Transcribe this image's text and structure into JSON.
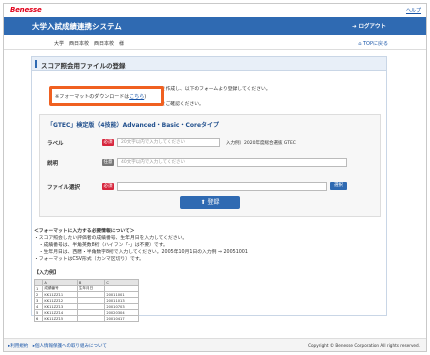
{
  "brand": {
    "logo_prefix": "Benesse",
    "help": "ヘルプ"
  },
  "header": {
    "title": "大学入試成績連携システム",
    "logout": "ログアウト"
  },
  "subbar": {
    "user": "大学　西日本校　西日本校　様",
    "toppage": "TOPに戻る"
  },
  "page": {
    "title": "スコア照会用ファイルの登録",
    "desc1": "会用ファイルを作成し、以下のフォームより登録してください。",
    "desc2": "ページの下部をご確認ください。",
    "download_prefix": "※フォーマットのダウンロードは",
    "download_link": "こちら"
  },
  "form": {
    "title": "「GTEC」検定版（4技能）Advanced・Basic・Coreタイプ",
    "label_field": {
      "label": "ラベル",
      "tag": "必須",
      "placeholder": "20文字以内で入力してください",
      "hint": "入力例）2020年度総合選抜 GTEC"
    },
    "note_field": {
      "label": "説明",
      "tag": "任意",
      "placeholder": "40文字以内で入力してください"
    },
    "file_field": {
      "label": "ファイル選択",
      "tag": "必須",
      "button": "選択"
    },
    "submit": "登録"
  },
  "notes": {
    "heading": "＜フォーマットに入力する必要情報について＞",
    "items": [
      "・スコア照会したい評価者の成績番号、生年月日を入力してください。",
      "　・成績番号は、半角英数8桁（ハイフン「-」は不要）です。",
      "　・生年月日は、西暦・半角数字8桁で入力してください。2005年10月1日の入力例 ⇒ 20051001",
      "・フォーマットはCSV形式（カンマ区切り）です。"
    ]
  },
  "sample": {
    "caption": "【入力例】",
    "header": [
      "",
      "A",
      "B",
      "C"
    ],
    "rows": [
      [
        "1",
        "成績番号",
        "生年月日",
        ""
      ],
      [
        "2",
        "KK11ZZ11",
        "",
        "20011001"
      ],
      [
        "3",
        "KK11ZZ12",
        "",
        "20011013"
      ],
      [
        "4",
        "KK11ZZ13",
        "",
        "20010703"
      ],
      [
        "5",
        "KK11ZZ14",
        "",
        "20020304"
      ],
      [
        "6",
        "KK11ZZ15",
        "",
        "20010417"
      ]
    ]
  },
  "footer": {
    "links": "▸利用規約　▸個人情報保護への取り組みについて",
    "copyright": "Copyright © Benesse Corporation All rights reserved."
  }
}
